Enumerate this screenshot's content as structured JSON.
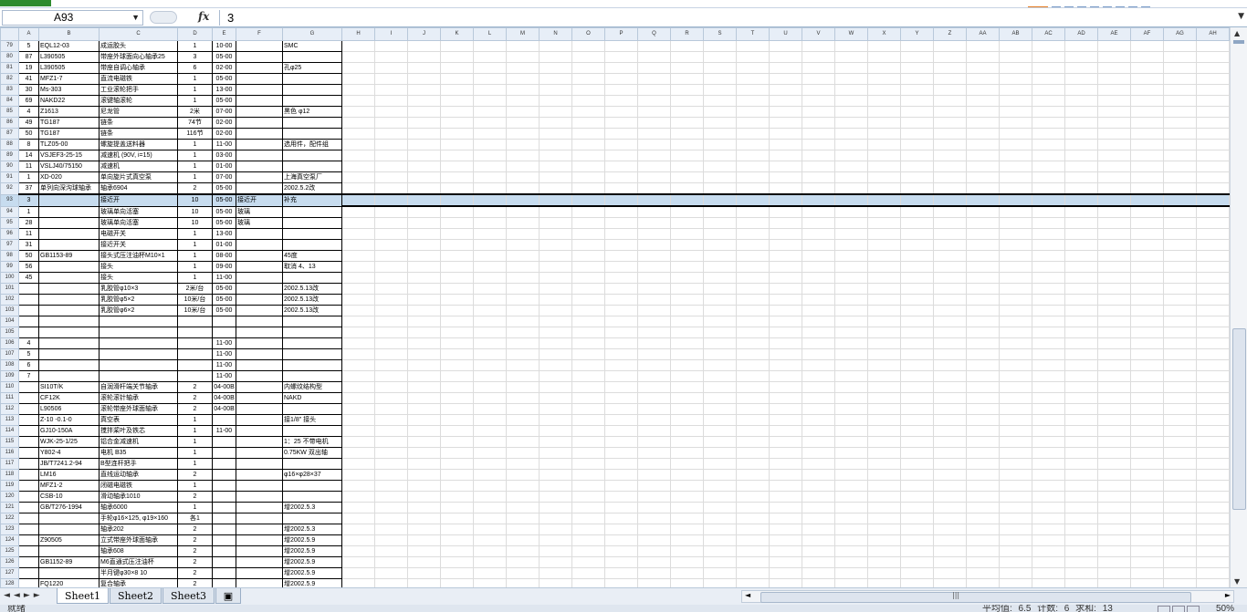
{
  "formula_bar": {
    "name_box": "A93",
    "fx_label": "fx",
    "value": "3"
  },
  "columns": [
    "A",
    "B",
    "C",
    "D",
    "E",
    "F",
    "G",
    "H",
    "I",
    "J",
    "K",
    "L",
    "M",
    "N",
    "O",
    "P",
    "Q",
    "R",
    "S",
    "T",
    "U",
    "V",
    "W",
    "X",
    "Y",
    "Z",
    "AA",
    "AB",
    "AC",
    "AD",
    "AE",
    "AF",
    "AG",
    "AH"
  ],
  "rows": [
    {
      "n": "79",
      "a": "5",
      "b": "EQL12-03",
      "c": "成运胶头",
      "d": "1",
      "e": "10-00",
      "f": "",
      "g": "SMC"
    },
    {
      "n": "80",
      "a": "87",
      "b": "L390505",
      "c": "带座外球面向心轴承25",
      "d": "3",
      "e": "05-00",
      "f": "",
      "g": ""
    },
    {
      "n": "81",
      "a": "19",
      "b": "L390505",
      "c": "带座自调心轴承",
      "d": "6",
      "e": "02-00",
      "f": "",
      "g": "孔φ25"
    },
    {
      "n": "82",
      "a": "41",
      "b": "MFZ1-7",
      "c": "直流电磁铁",
      "d": "1",
      "e": "05-00",
      "f": "",
      "g": ""
    },
    {
      "n": "83",
      "a": "30",
      "b": "Ms-303",
      "c": "工业滚轮把手",
      "d": "1",
      "e": "13-00",
      "f": "",
      "g": ""
    },
    {
      "n": "84",
      "a": "69",
      "b": "NAKD22",
      "c": "滚键轴滚轮",
      "d": "1",
      "e": "05-00",
      "f": "",
      "g": ""
    },
    {
      "n": "85",
      "a": "4",
      "b": "Z1613",
      "c": "尼龙管",
      "d": "2米",
      "e": "07-00",
      "f": "",
      "g": "黑色 φ12"
    },
    {
      "n": "86",
      "a": "49",
      "b": "TG187",
      "c": "链条",
      "d": "74节",
      "e": "02-00",
      "f": "",
      "g": ""
    },
    {
      "n": "87",
      "a": "50",
      "b": "TG187",
      "c": "链条",
      "d": "116节",
      "e": "02-00",
      "f": "",
      "g": ""
    },
    {
      "n": "88",
      "a": "8",
      "b": "TLZ05-00",
      "c": "螺旋提盖送料器",
      "d": "1",
      "e": "11-00",
      "f": "",
      "g": "选用件，配件组"
    },
    {
      "n": "89",
      "a": "14",
      "b": "VSJEF3-25-15",
      "c": "减速机 (90V, i=15)",
      "d": "1",
      "e": "03-00",
      "f": "",
      "g": ""
    },
    {
      "n": "90",
      "a": "11",
      "b": "VSLJ40/75150",
      "c": "减速机",
      "d": "1",
      "e": "01-00",
      "f": "",
      "g": ""
    },
    {
      "n": "91",
      "a": "1",
      "b": "XD-020",
      "c": "单向旋片式真空泵",
      "d": "1",
      "e": "07-00",
      "f": "",
      "g": "上海真空泵厂"
    },
    {
      "n": "92",
      "a": "37",
      "b": "单列向深沟球轴承",
      "c": "轴承6904",
      "d": "2",
      "e": "05-00",
      "f": "",
      "g": "2002.5.2改"
    },
    {
      "n": "93",
      "a": "3",
      "b": "",
      "c": "接近开",
      "d": "10",
      "e": "05-00",
      "f": "接近开",
      "g": "补充",
      "sel": true
    },
    {
      "n": "94",
      "a": "1",
      "b": "",
      "c": "玻璃单向活塞",
      "d": "10",
      "e": "05-00",
      "f": "玻璃",
      "g": ""
    },
    {
      "n": "95",
      "a": "28",
      "b": "",
      "c": "玻璃单向活塞",
      "d": "10",
      "e": "05-00",
      "f": "玻璃",
      "g": ""
    },
    {
      "n": "96",
      "a": "11",
      "b": "",
      "c": "电磁开关",
      "d": "1",
      "e": "13-00",
      "f": "",
      "g": ""
    },
    {
      "n": "97",
      "a": "31",
      "b": "",
      "c": "接近开关",
      "d": "1",
      "e": "01-00",
      "f": "",
      "g": ""
    },
    {
      "n": "98",
      "a": "50",
      "b": "GB1153-89",
      "c": "接头式压注油杯M10×1",
      "d": "1",
      "e": "08-00",
      "f": "",
      "g": "45度"
    },
    {
      "n": "99",
      "a": "56",
      "b": "",
      "c": "接头",
      "d": "1",
      "e": "09-00",
      "f": "",
      "g": "取消 4、13"
    },
    {
      "n": "100",
      "a": "45",
      "b": "",
      "c": "接头",
      "d": "1",
      "e": "11-00",
      "f": "",
      "g": ""
    },
    {
      "n": "101",
      "a": "",
      "b": "",
      "c": "乳胶管φ10×3",
      "d": "2米/台",
      "e": "05-00",
      "f": "",
      "g": "2002.5.13改"
    },
    {
      "n": "102",
      "a": "",
      "b": "",
      "c": "乳胶管φ5×2",
      "d": "10米/台",
      "e": "05-00",
      "f": "",
      "g": "2002.5.13改"
    },
    {
      "n": "103",
      "a": "",
      "b": "",
      "c": "乳胶管φ6×2",
      "d": "10米/台",
      "e": "05-00",
      "f": "",
      "g": "2002.5.13改"
    },
    {
      "n": "104",
      "a": "",
      "b": "",
      "c": "",
      "d": "",
      "e": "",
      "f": "",
      "g": ""
    },
    {
      "n": "105",
      "a": "",
      "b": "",
      "c": "",
      "d": "",
      "e": "",
      "f": "",
      "g": ""
    },
    {
      "n": "106",
      "a": "4",
      "b": "",
      "c": "",
      "d": "",
      "e": "11-00",
      "f": "",
      "g": ""
    },
    {
      "n": "107",
      "a": "5",
      "b": "",
      "c": "",
      "d": "",
      "e": "11-00",
      "f": "",
      "g": ""
    },
    {
      "n": "108",
      "a": "6",
      "b": "",
      "c": "",
      "d": "",
      "e": "11-00",
      "f": "",
      "g": ""
    },
    {
      "n": "109",
      "a": "7",
      "b": "",
      "c": "",
      "d": "",
      "e": "11-00",
      "f": "",
      "g": ""
    },
    {
      "n": "110",
      "a": "",
      "b": "SI10T/K",
      "c": "自润滑杆端关节轴承",
      "d": "2",
      "e": "04-00B",
      "f": "",
      "g": "内螺纹结构型"
    },
    {
      "n": "111",
      "a": "",
      "b": "CF12K",
      "c": "滚轮滚针轴承",
      "d": "2",
      "e": "04-00B",
      "f": "",
      "g": "NAKD"
    },
    {
      "n": "112",
      "a": "",
      "b": "L90506",
      "c": "滚轮带座外球面轴承",
      "d": "2",
      "e": "04-00B",
      "f": "",
      "g": ""
    },
    {
      "n": "113",
      "a": "",
      "b": "Z-10 -0.1-0",
      "c": "真空表",
      "d": "1",
      "e": "",
      "f": "",
      "g": "接1/8\" 接头"
    },
    {
      "n": "114",
      "a": "",
      "b": "GJ10-150A",
      "c": "搅拌桨叶及铁芯",
      "d": "1",
      "e": "11-00",
      "f": "",
      "g": ""
    },
    {
      "n": "115",
      "a": "",
      "b": "WJK-25-1/25",
      "c": "铝合金减速机",
      "d": "1",
      "e": "",
      "f": "",
      "g": "1：25 不带电机"
    },
    {
      "n": "116",
      "a": "",
      "b": "Y802-4",
      "c": "电机    B35",
      "d": "1",
      "e": "",
      "f": "",
      "g": "0.75KW 双出轴"
    },
    {
      "n": "117",
      "a": "",
      "b": "JB/T7241.2-94",
      "c": "B型连杆把手",
      "d": "1",
      "e": "",
      "f": "",
      "g": ""
    },
    {
      "n": "118",
      "a": "",
      "b": "LM16",
      "c": "直线运动轴承",
      "d": "2",
      "e": "",
      "f": "",
      "g": "φ16×φ28×37"
    },
    {
      "n": "119",
      "a": "",
      "b": "MFZ1-2",
      "c": "闭磁电磁铁",
      "d": "1",
      "e": "",
      "f": "",
      "g": ""
    },
    {
      "n": "120",
      "a": "",
      "b": "CSB-10",
      "c": "滑动轴承1010",
      "d": "2",
      "e": "",
      "f": "",
      "g": ""
    },
    {
      "n": "121",
      "a": "",
      "b": "GB/T276-1994",
      "c": "轴承6000",
      "d": "1",
      "e": "",
      "f": "",
      "g": "增2002.5.3"
    },
    {
      "n": "122",
      "a": "",
      "b": "",
      "c": "手轮φ16×125, φ19×160",
      "d": "各1",
      "e": "",
      "f": "",
      "g": ""
    },
    {
      "n": "123",
      "a": "",
      "b": "",
      "c": "轴承202",
      "d": "2",
      "e": "",
      "f": "",
      "g": "增2002.5.3"
    },
    {
      "n": "124",
      "a": "",
      "b": "Z90505",
      "c": "立式带座外球面轴承",
      "d": "2",
      "e": "",
      "f": "",
      "g": "增2002.5.9"
    },
    {
      "n": "125",
      "a": "",
      "b": "",
      "c": "轴承608",
      "d": "2",
      "e": "",
      "f": "",
      "g": "增2002.5.9"
    },
    {
      "n": "126",
      "a": "",
      "b": "GB1152-89",
      "c": "M6直通式压注油杯",
      "d": "2",
      "e": "",
      "f": "",
      "g": "增2002.5.9"
    },
    {
      "n": "127",
      "a": "",
      "b": "",
      "c": "半月键φ30×8 10",
      "d": "2",
      "e": "",
      "f": "",
      "g": "增2002.5.9"
    },
    {
      "n": "128",
      "a": "",
      "b": "FQ1220",
      "c": "复合轴承",
      "d": "2",
      "e": "",
      "f": "",
      "g": "增2002.5.9"
    }
  ],
  "sheet_tabs": [
    "Sheet1",
    "Sheet2",
    "Sheet3"
  ],
  "active_tab": "Sheet1",
  "status": {
    "ready": "就绪",
    "average": "平均值: 6.5",
    "count": "计数: 6",
    "sum": "求和: 13",
    "zoom": "50%"
  }
}
